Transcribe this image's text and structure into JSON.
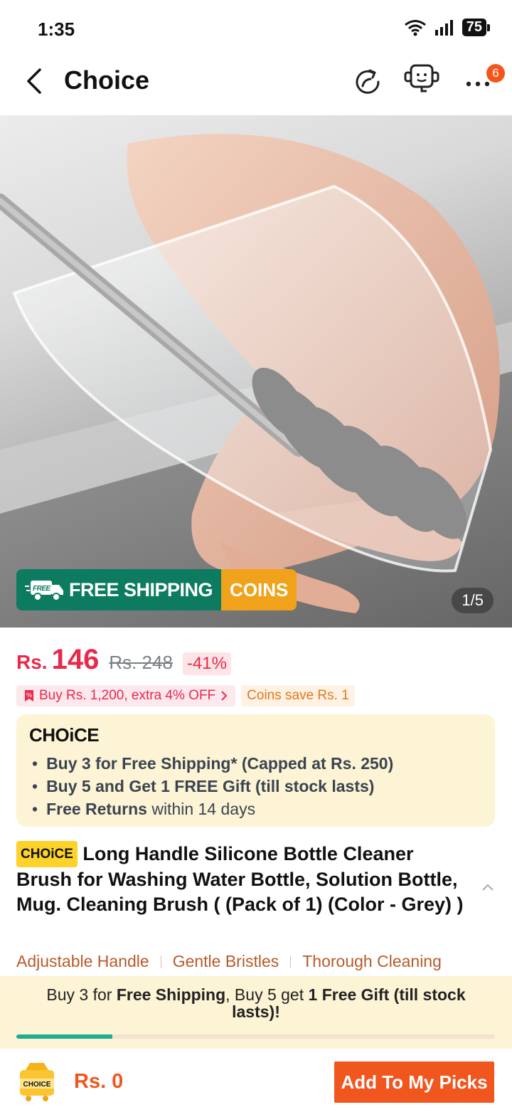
{
  "status": {
    "time": "1:35",
    "battery": "75",
    "icons": [
      "wifi-icon",
      "signal-icon",
      "battery-icon"
    ]
  },
  "header": {
    "title": "Choice",
    "back_icon": "chevron-left-icon",
    "icons": [
      "refresh-share-icon",
      "customer-service-icon",
      "more-icon"
    ],
    "notification_count": "6"
  },
  "hero": {
    "free_shipping_label": "FREE SHIPPING",
    "free_icon_label": "FREE",
    "coins_label": "COINS",
    "counter": "1/5"
  },
  "price": {
    "currency": "Rs.",
    "current": "146",
    "original": "Rs. 248",
    "discount": "-41%"
  },
  "chips": {
    "bundle": "Buy Rs. 1,200, extra 4% OFF",
    "coins": "Coins save Rs. 1"
  },
  "choice_box": {
    "logo": "CHOiCE",
    "line1_bold": "Buy 3 for  Free Shipping* (Capped at Rs. 250)",
    "line2_bold": "Buy 5 and Get 1 FREE Gift (till stock lasts)",
    "line3_bold": "Free Returns",
    "line3_rest": " within 14 days"
  },
  "product": {
    "tag": "CHOiCE",
    "title": "Long Handle Silicone Bottle Cleaner Brush for Washing Water Bottle, Solution Bottle, Mug. Cleaning Brush ( (Pack of 1) (Color - Grey) )"
  },
  "features": [
    "Adjustable Handle",
    "Gentle Bristles",
    "Thorough Cleaning"
  ],
  "banner": {
    "t1": "Buy 3 for ",
    "t2": "Free Shipping",
    "t3": ", Buy 5 get ",
    "t4": "1 Free Gift (till stock lasts)!",
    "progress": 0.2
  },
  "bottom": {
    "cart_label": "CHOICE",
    "price": "Rs. 0",
    "button": "Add To My Picks"
  },
  "colors": {
    "accent": "#f0561e",
    "price_red": "#e8294a",
    "green": "#0c7b5f",
    "gold": "#f0a21a"
  }
}
